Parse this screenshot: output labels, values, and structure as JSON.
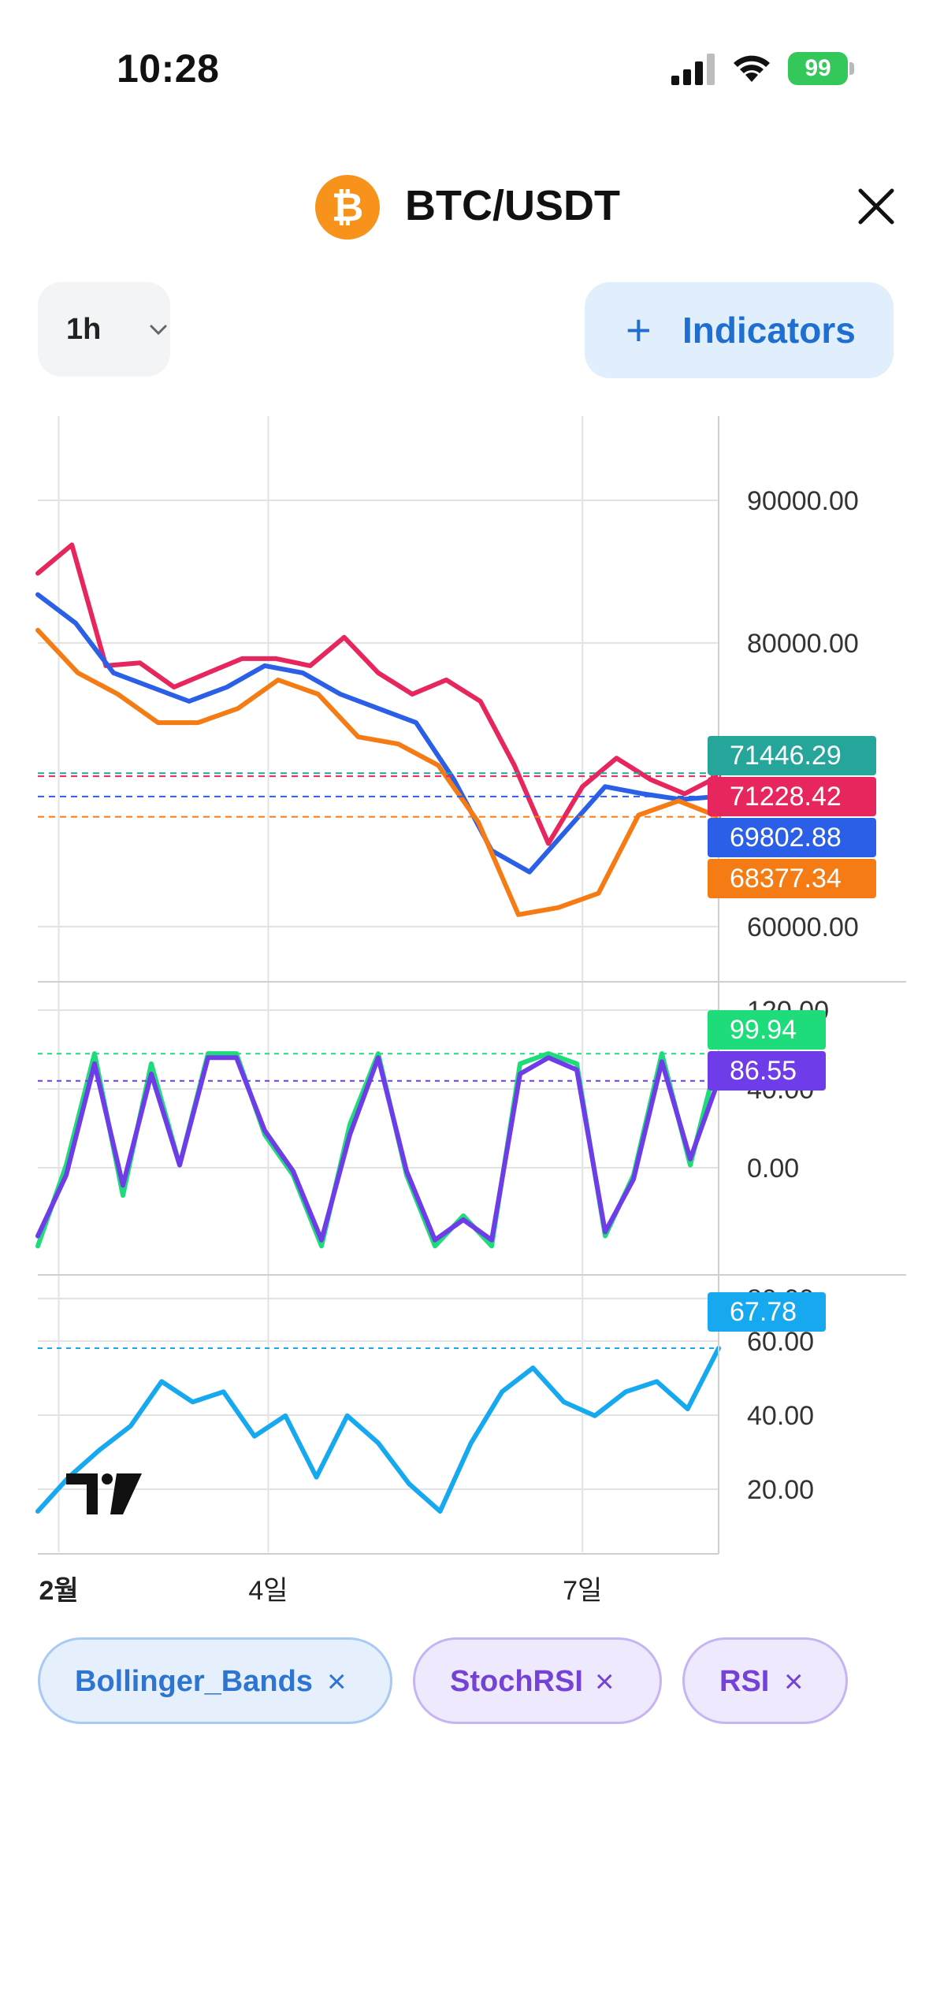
{
  "status": {
    "time": "10:28",
    "battery": "99"
  },
  "header": {
    "coin_symbol": "₿",
    "pair": "BTC/USDT"
  },
  "toolbar": {
    "interval": "1h",
    "indicators_plus": "+",
    "indicators_label": "Indicators"
  },
  "colors": {
    "upper_band": "#e8265e",
    "middle_band": "#2b5fe8",
    "lower_band": "#f57c14",
    "last_price": "#26a69a",
    "stoch_k": "#1fdc7a",
    "stoch_d": "#6e3ce8",
    "rsi": "#16a9f0",
    "chip_blue_bg": "#e6f0fd",
    "chip_purple_bg": "#efe9fd"
  },
  "chart_data": [
    {
      "type": "line",
      "panel": "price",
      "y_ticks": [
        "90000.00",
        "80000.00",
        "60000.00"
      ],
      "ylim": [
        57000,
        97000
      ],
      "x_ticks": [
        "2월",
        "4일",
        "7일"
      ],
      "x_tick_days": [
        2,
        4,
        7
      ],
      "xlim": [
        1.8,
        8.3
      ],
      "series": [
        {
          "name": "upper",
          "values": [
            85500,
            87500,
            79000,
            79200,
            77500,
            78500,
            79500,
            79500,
            79000,
            81000,
            78500,
            77000,
            78000,
            76500,
            72000,
            66500,
            70500,
            72500,
            71000,
            70000,
            71228
          ]
        },
        {
          "name": "middle",
          "values": [
            84000,
            82000,
            78500,
            77500,
            76500,
            77500,
            79000,
            78500,
            77000,
            76000,
            75000,
            71000,
            66000,
            64500,
            67500,
            70500,
            70000,
            69600,
            69802
          ]
        },
        {
          "name": "lower",
          "values": [
            81500,
            78500,
            77000,
            75000,
            75000,
            76000,
            78000,
            77000,
            74000,
            73500,
            72000,
            68000,
            61500,
            62000,
            63000,
            68500,
            69500,
            68377
          ]
        }
      ],
      "last_price": "71446.29",
      "upper_label": "71228.42",
      "middle_label": "69802.88",
      "lower_label": "68377.34"
    },
    {
      "type": "line",
      "panel": "stochrsi",
      "y_ticks": [
        "120.00",
        "40.00",
        "0.00"
      ],
      "ylim": [
        -10,
        130
      ],
      "series": [
        {
          "name": "K",
          "values": [
            5,
            45,
            100,
            30,
            95,
            45,
            100,
            100,
            60,
            40,
            5,
            65,
            100,
            40,
            5,
            20,
            5,
            95,
            100,
            95,
            10,
            40,
            100,
            45,
            100
          ]
        },
        {
          "name": "D",
          "values": [
            10,
            40,
            95,
            35,
            90,
            45,
            98,
            98,
            62,
            42,
            8,
            60,
            98,
            42,
            8,
            18,
            8,
            90,
            98,
            92,
            12,
            38,
            96,
            48,
            87
          ]
        }
      ],
      "k_label": "99.94",
      "d_label": "86.55"
    },
    {
      "type": "line",
      "panel": "rsi",
      "y_ticks": [
        "80.00",
        "60.00",
        "40.00",
        "20.00"
      ],
      "ylim": [
        8,
        86
      ],
      "series": [
        {
          "name": "RSI",
          "values": [
            20,
            30,
            38,
            45,
            58,
            52,
            55,
            42,
            48,
            30,
            48,
            40,
            28,
            20,
            40,
            55,
            62,
            52,
            48,
            55,
            58,
            50,
            67.78
          ]
        }
      ],
      "rsi_label": "67.78"
    }
  ],
  "chips": [
    {
      "label": "Bollinger_Bands",
      "x": "×"
    },
    {
      "label": "StochRSI",
      "x": "×"
    },
    {
      "label": "RSI",
      "x": "×"
    }
  ]
}
